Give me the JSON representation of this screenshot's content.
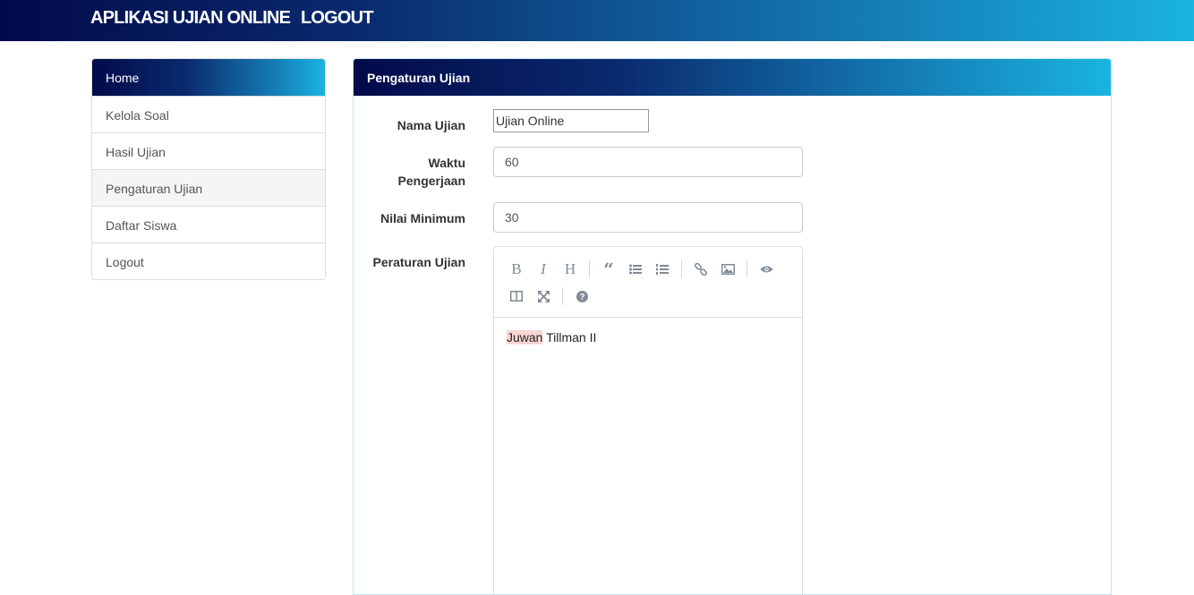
{
  "header": {
    "brand": "APLIKASI UJIAN ONLINE",
    "logout": "LOGOUT"
  },
  "sidebar": {
    "head": "Home",
    "items": [
      {
        "label": "Kelola Soal"
      },
      {
        "label": "Hasil Ujian"
      },
      {
        "label": "Pengaturan Ujian"
      },
      {
        "label": "Daftar Siswa"
      },
      {
        "label": "Logout"
      }
    ]
  },
  "panel": {
    "title": "Pengaturan Ujian",
    "fields": {
      "nama_label": "Nama Ujian",
      "nama_value": "Ujian Online",
      "waktu_label_1": "Waktu",
      "waktu_label_2": "Pengerjaan",
      "waktu_value": "60",
      "nilai_label": "Nilai Minimum",
      "nilai_value": "30",
      "peraturan_label": "Peraturan Ujian"
    },
    "editor": {
      "toolbar": [
        "bold-icon",
        "italic-icon",
        "heading-icon",
        "quote-icon",
        "unordered-list-icon",
        "ordered-list-icon",
        "link-icon",
        "image-icon",
        "preview-icon",
        "side-by-side-icon",
        "fullscreen-icon",
        "help-icon"
      ],
      "content_word1": "Juwan",
      "content_rest": " Tillman II"
    }
  }
}
